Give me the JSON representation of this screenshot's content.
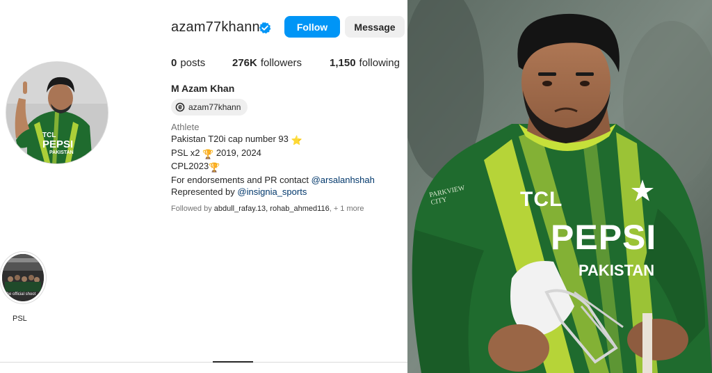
{
  "profile": {
    "username": "azam77khann",
    "follow_label": "Follow",
    "message_label": "Message",
    "posts_count": "0",
    "posts_label": "posts",
    "followers_count": "276K",
    "followers_label": "followers",
    "following_count": "1,150",
    "following_label": "following",
    "full_name": "M Azam Khan",
    "threads_handle": "azam77khann",
    "category": "Athlete",
    "bio_line1": "Pakistan T20i cap number 93 ",
    "bio_line1_emoji": "⭐",
    "bio_line2_a": "PSL x2 ",
    "bio_line2_emoji": "🏆",
    "bio_line2_b": " 2019, 2024",
    "bio_line3_a": "CPL2023",
    "bio_line3_emoji": "🏆",
    "bio_line4_a": "For endorsements and PR contact ",
    "bio_line4_link": "@arsalanhshah",
    "bio_line5_a": "Represented by ",
    "bio_line5_link": "@insignia_sports",
    "followed_by_prefix": "Followed by ",
    "followed_by_names": "abdull_rafay.13, rohab_ahmed116",
    "followed_by_more": ", + 1 more"
  },
  "highlights": [
    {
      "label": "PSL",
      "thumb_text": "The official shoot"
    }
  ],
  "avatar": {
    "jersey_sponsor_top": "TCL",
    "jersey_sponsor": "PEPSI",
    "jersey_country": "PAKISTAN"
  },
  "photo": {
    "jersey_top": "TCL",
    "jersey_sponsor": "PEPSI",
    "jersey_country": "PAKISTAN",
    "sleeve_text": "PARKVIEW CITY"
  },
  "colors": {
    "accent": "#0095f6",
    "link": "#00376b",
    "jersey_green": "#1f6b2e",
    "jersey_lime": "#c6e03a"
  },
  "icons": {
    "verified": "verified-badge-icon",
    "threads": "threads-icon"
  }
}
